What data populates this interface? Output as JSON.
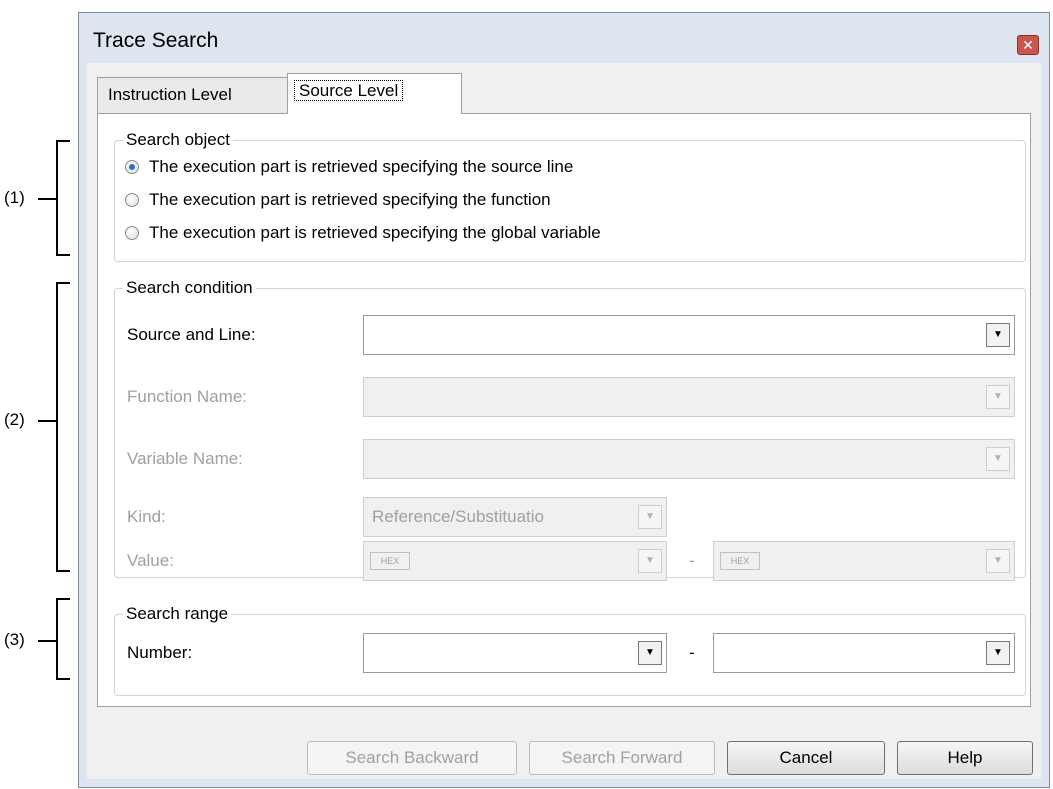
{
  "annotations": [
    "(1)",
    "(2)",
    "(3)"
  ],
  "window": {
    "title": "Trace Search",
    "close_icon": "close-icon"
  },
  "tabs": [
    {
      "label": "Instruction Level",
      "active": false
    },
    {
      "label": "Source Level",
      "active": true
    }
  ],
  "search_object": {
    "title": "Search object",
    "options": [
      {
        "label": "The execution part is retrieved specifying the source line",
        "checked": true
      },
      {
        "label": "The execution part is retrieved specifying the function",
        "checked": false
      },
      {
        "label": "The execution part is retrieved specifying the global variable",
        "checked": false
      }
    ]
  },
  "search_condition": {
    "title": "Search condition",
    "source_and_line": {
      "label": "Source and Line:",
      "value": ""
    },
    "function_name": {
      "label": "Function Name:",
      "value": ""
    },
    "variable_name": {
      "label": "Variable Name:",
      "value": ""
    },
    "kind": {
      "label": "Kind:",
      "value": "Reference/Substituatio"
    },
    "value": {
      "label": "Value:",
      "from_badge": "HEX",
      "to_badge": "HEX",
      "separator": "-"
    }
  },
  "search_range": {
    "title": "Search range",
    "number": {
      "label": "Number:",
      "separator": "-"
    }
  },
  "buttons": {
    "search_backward": "Search Backward",
    "search_forward": "Search Forward",
    "cancel": "Cancel",
    "help": "Help"
  }
}
